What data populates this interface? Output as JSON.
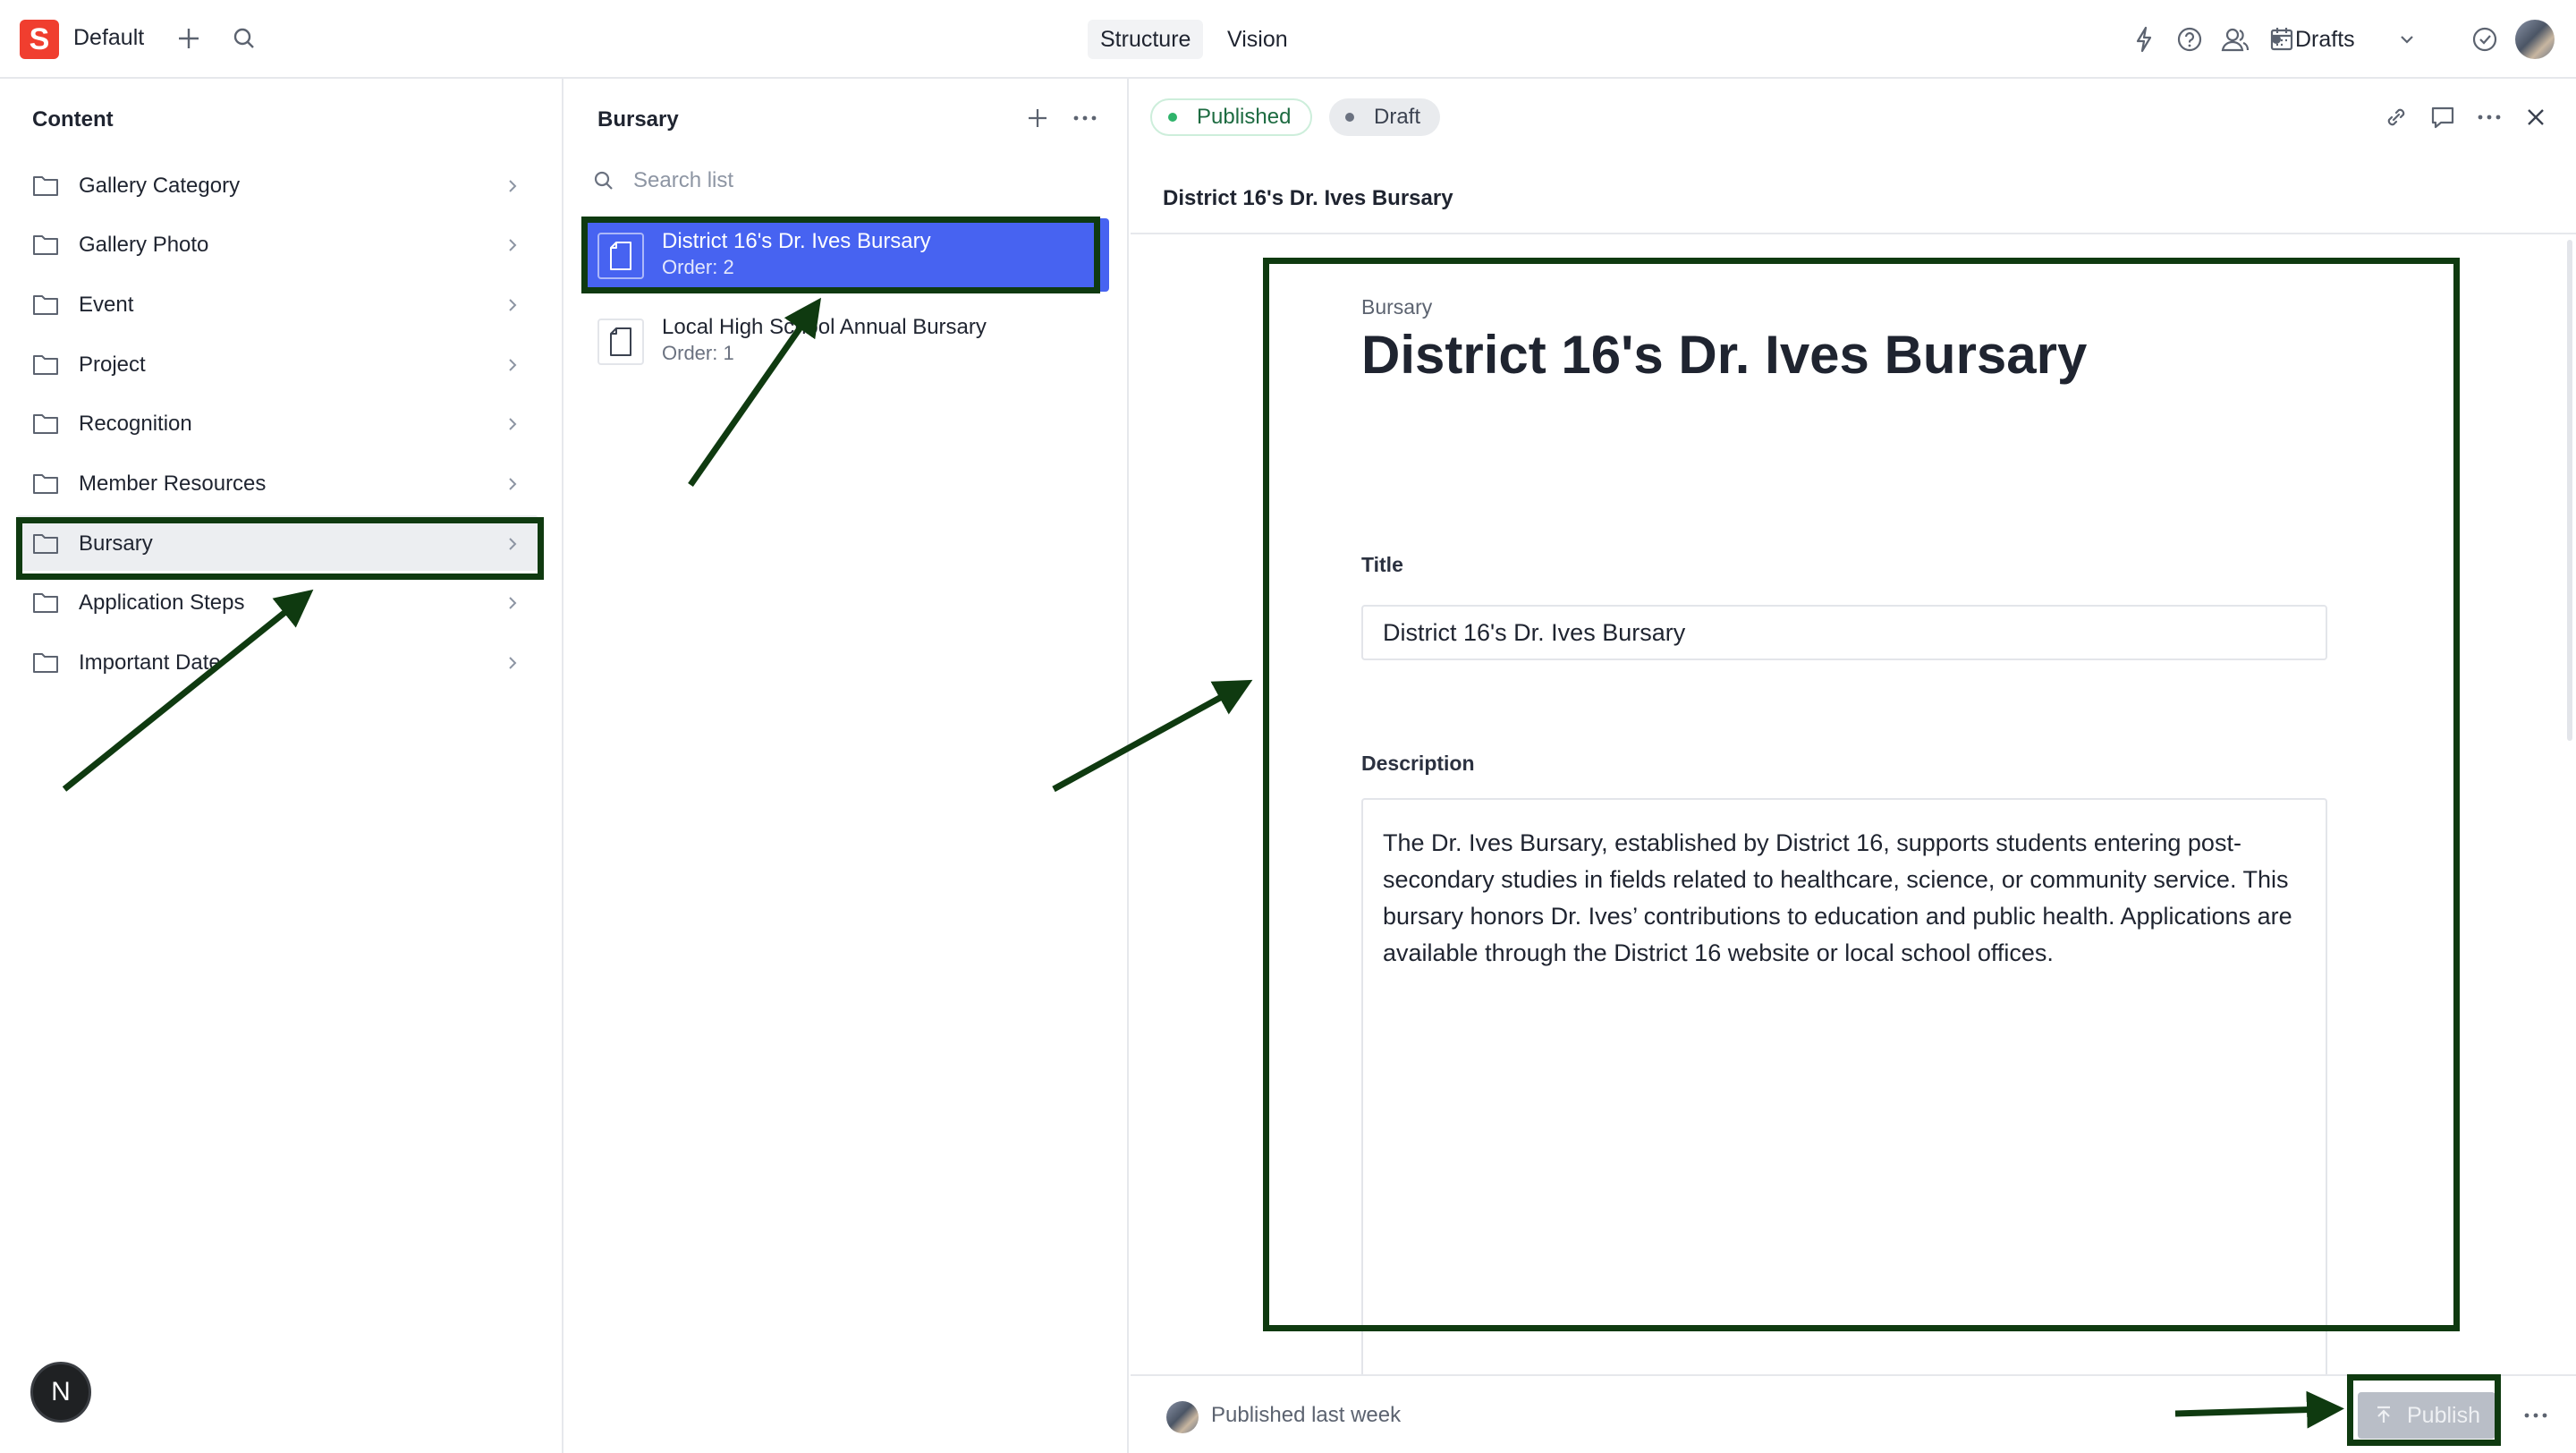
{
  "navbar": {
    "logo_letter": "S",
    "workspace": "Default",
    "tabs": [
      {
        "label": "Structure"
      },
      {
        "label": "Vision"
      }
    ],
    "drafts_label": "Drafts"
  },
  "content_pane": {
    "title": "Content",
    "items": [
      {
        "label": "Gallery Category"
      },
      {
        "label": "Gallery Photo"
      },
      {
        "label": "Event"
      },
      {
        "label": "Project"
      },
      {
        "label": "Recognition"
      },
      {
        "label": "Member Resources"
      },
      {
        "label": "Bursary",
        "selected": true
      },
      {
        "label": "Application Steps"
      },
      {
        "label": "Important Date"
      }
    ]
  },
  "list_pane": {
    "title": "Bursary",
    "search_placeholder": "Search list",
    "documents": [
      {
        "title": "District 16's Dr. Ives Bursary",
        "subtitle": "Order: 2",
        "selected": true
      },
      {
        "title": "Local High School Annual Bursary",
        "subtitle": "Order: 1",
        "selected": false
      }
    ]
  },
  "editor": {
    "status_pills": {
      "published": "Published",
      "draft": "Draft"
    },
    "header_title": "District 16's Dr. Ives Bursary",
    "type_label": "Bursary",
    "main_title": "District 16's Dr. Ives Bursary",
    "fields": {
      "title_label": "Title",
      "title_value": "District 16's Dr. Ives Bursary",
      "description_label": "Description",
      "description_value": "The Dr. Ives Bursary, established by District 16, supports students entering post-secondary studies in fields related to healthcare, science, or community service. This bursary honors Dr. Ives’ contributions to education and public health. Applications are available through the District 16 website or local school offices."
    },
    "footer": {
      "status": "Published last week",
      "publish_label": "Publish"
    }
  },
  "floating_badge": "N",
  "colors": {
    "brand": "#f03e2f",
    "selected_doc": "#4763f1",
    "published_dot": "#2fb36b",
    "annotation": "#0f3a10"
  }
}
